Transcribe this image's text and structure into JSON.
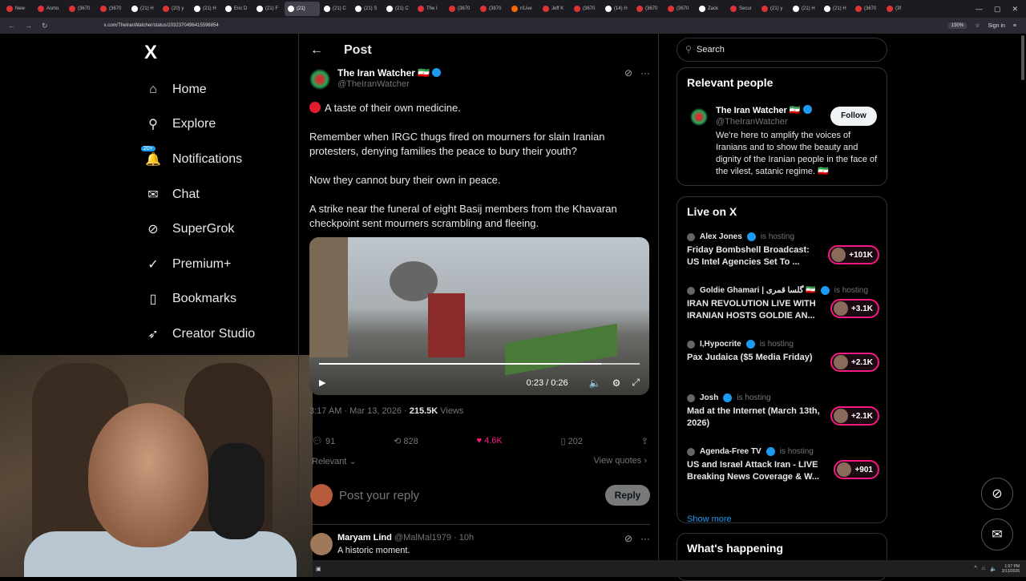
{
  "browser": {
    "tabs": [
      {
        "label": "New",
        "color": "#d33"
      },
      {
        "label": "Asmo",
        "color": "#d33"
      },
      {
        "label": "(3670",
        "color": "#d33"
      },
      {
        "label": "(3670",
        "color": "#d33"
      },
      {
        "label": "(21) H",
        "color": "#fff"
      },
      {
        "label": "(20) y",
        "color": "#d33"
      },
      {
        "label": "(21) H",
        "color": "#fff"
      },
      {
        "label": "Eric D",
        "color": "#fff"
      },
      {
        "label": "(21) F",
        "color": "#fff"
      },
      {
        "label": "(21)",
        "color": "#fff",
        "active": true
      },
      {
        "label": "(21) C",
        "color": "#fff"
      },
      {
        "label": "(21) S",
        "color": "#fff"
      },
      {
        "label": "(21) C",
        "color": "#fff"
      },
      {
        "label": "The I",
        "color": "#d33"
      },
      {
        "label": "(3670",
        "color": "#d33"
      },
      {
        "label": "(3670",
        "color": "#d33"
      },
      {
        "label": "r/Live",
        "color": "#f60"
      },
      {
        "label": "Jeff K",
        "color": "#d33"
      },
      {
        "label": "(3670",
        "color": "#d33"
      },
      {
        "label": "(14) H",
        "color": "#fff"
      },
      {
        "label": "(3670",
        "color": "#d33"
      },
      {
        "label": "(3670",
        "color": "#d33"
      },
      {
        "label": "Zack",
        "color": "#fff"
      },
      {
        "label": "Secur",
        "color": "#d33"
      },
      {
        "label": "(21) y",
        "color": "#d33"
      },
      {
        "label": "(21) H",
        "color": "#fff"
      },
      {
        "label": "(21) H",
        "color": "#fff"
      },
      {
        "label": "(3670",
        "color": "#d33"
      },
      {
        "label": "(3f",
        "color": "#d33"
      }
    ],
    "url": "x.com/TheIranWatcher/status/2032370496415596854",
    "zoom": "150%",
    "signin": "Sign in"
  },
  "sidebar": {
    "logo": "X",
    "items": [
      {
        "label": "Home",
        "icon": "⌂"
      },
      {
        "label": "Explore",
        "icon": "⚲"
      },
      {
        "label": "Notifications",
        "icon": "🔔",
        "badge": "20+"
      },
      {
        "label": "Chat",
        "icon": "✉"
      },
      {
        "label": "SuperGrok",
        "icon": "⊘"
      },
      {
        "label": "Premium+",
        "icon": "✓"
      },
      {
        "label": "Bookmarks",
        "icon": "▯"
      },
      {
        "label": "Creator Studio",
        "icon": "➶"
      }
    ]
  },
  "post": {
    "header_title": "Post",
    "author_name": "The Iran Watcher 🇮🇷",
    "author_handle": "@TheIranWatcher",
    "paragraphs": [
      "A taste of their own medicine.",
      "Remember when IRGC thugs fired on mourners for slain Iranian protesters, denying families the peace to bury their youth?",
      "Now they cannot bury their own in peace.",
      "A strike near the funeral of eight Basij members from the Khavaran checkpoint sent mourners scrambling and fleeing."
    ],
    "video_time": "0:23 / 0:26",
    "video_progress": 0.88,
    "meta_time": "3:17 AM · Mar 13, 2026 · ",
    "views_count": "215.5K",
    "views_label": " Views",
    "stats": {
      "replies": "91",
      "reposts": "828",
      "likes": "4.6K",
      "bookmarks": "202"
    },
    "relevant_label": "Relevant ⌄",
    "view_quotes": "View quotes ›",
    "reply_placeholder": "Post your reply",
    "reply_button": "Reply"
  },
  "reply": {
    "name": "Maryam Lind",
    "handle_time": " @MalMal1979 · 10h",
    "text": "A historic moment."
  },
  "right": {
    "search_placeholder": "Search",
    "relevant_title": "Relevant people",
    "person": {
      "name": "The Iran Watcher 🇮🇷",
      "handle": "@TheIranWatcher",
      "bio": "We're here to amplify the voices of Iranians and to show the beauty and dignity of the Iranian people in the face of the vilest, satanic regime. 🇮🇷",
      "follow": "Follow"
    },
    "live_title": "Live on X",
    "is_hosting": "is hosting",
    "live": [
      {
        "host": "Alex Jones",
        "title": "Friday Bombshell Broadcast: US Intel Agencies Set To ...",
        "count": "+101K"
      },
      {
        "host": "Goldie Ghamari | گلسا قمری 🇮🇷",
        "title": "IRAN REVOLUTION LIVE WITH IRANIAN HOSTS GOLDIE AN...",
        "count": "+3.1K"
      },
      {
        "host": "I,Hypocrite",
        "title": "Pax Judaica ($5 Media Friday)",
        "count": "+2.1K"
      },
      {
        "host": "Josh",
        "title": "Mad at the Internet (March 13th, 2026)",
        "count": "+2.1K"
      },
      {
        "host": "Agenda-Free TV",
        "title": "US and Israel Attack Iran - LIVE Breaking News Coverage & W...",
        "count": "+901"
      }
    ],
    "show_more": "Show more",
    "whats_happening": "What's happening"
  },
  "taskbar": {
    "time": "1:57 PM",
    "date": "3/13/2026"
  }
}
